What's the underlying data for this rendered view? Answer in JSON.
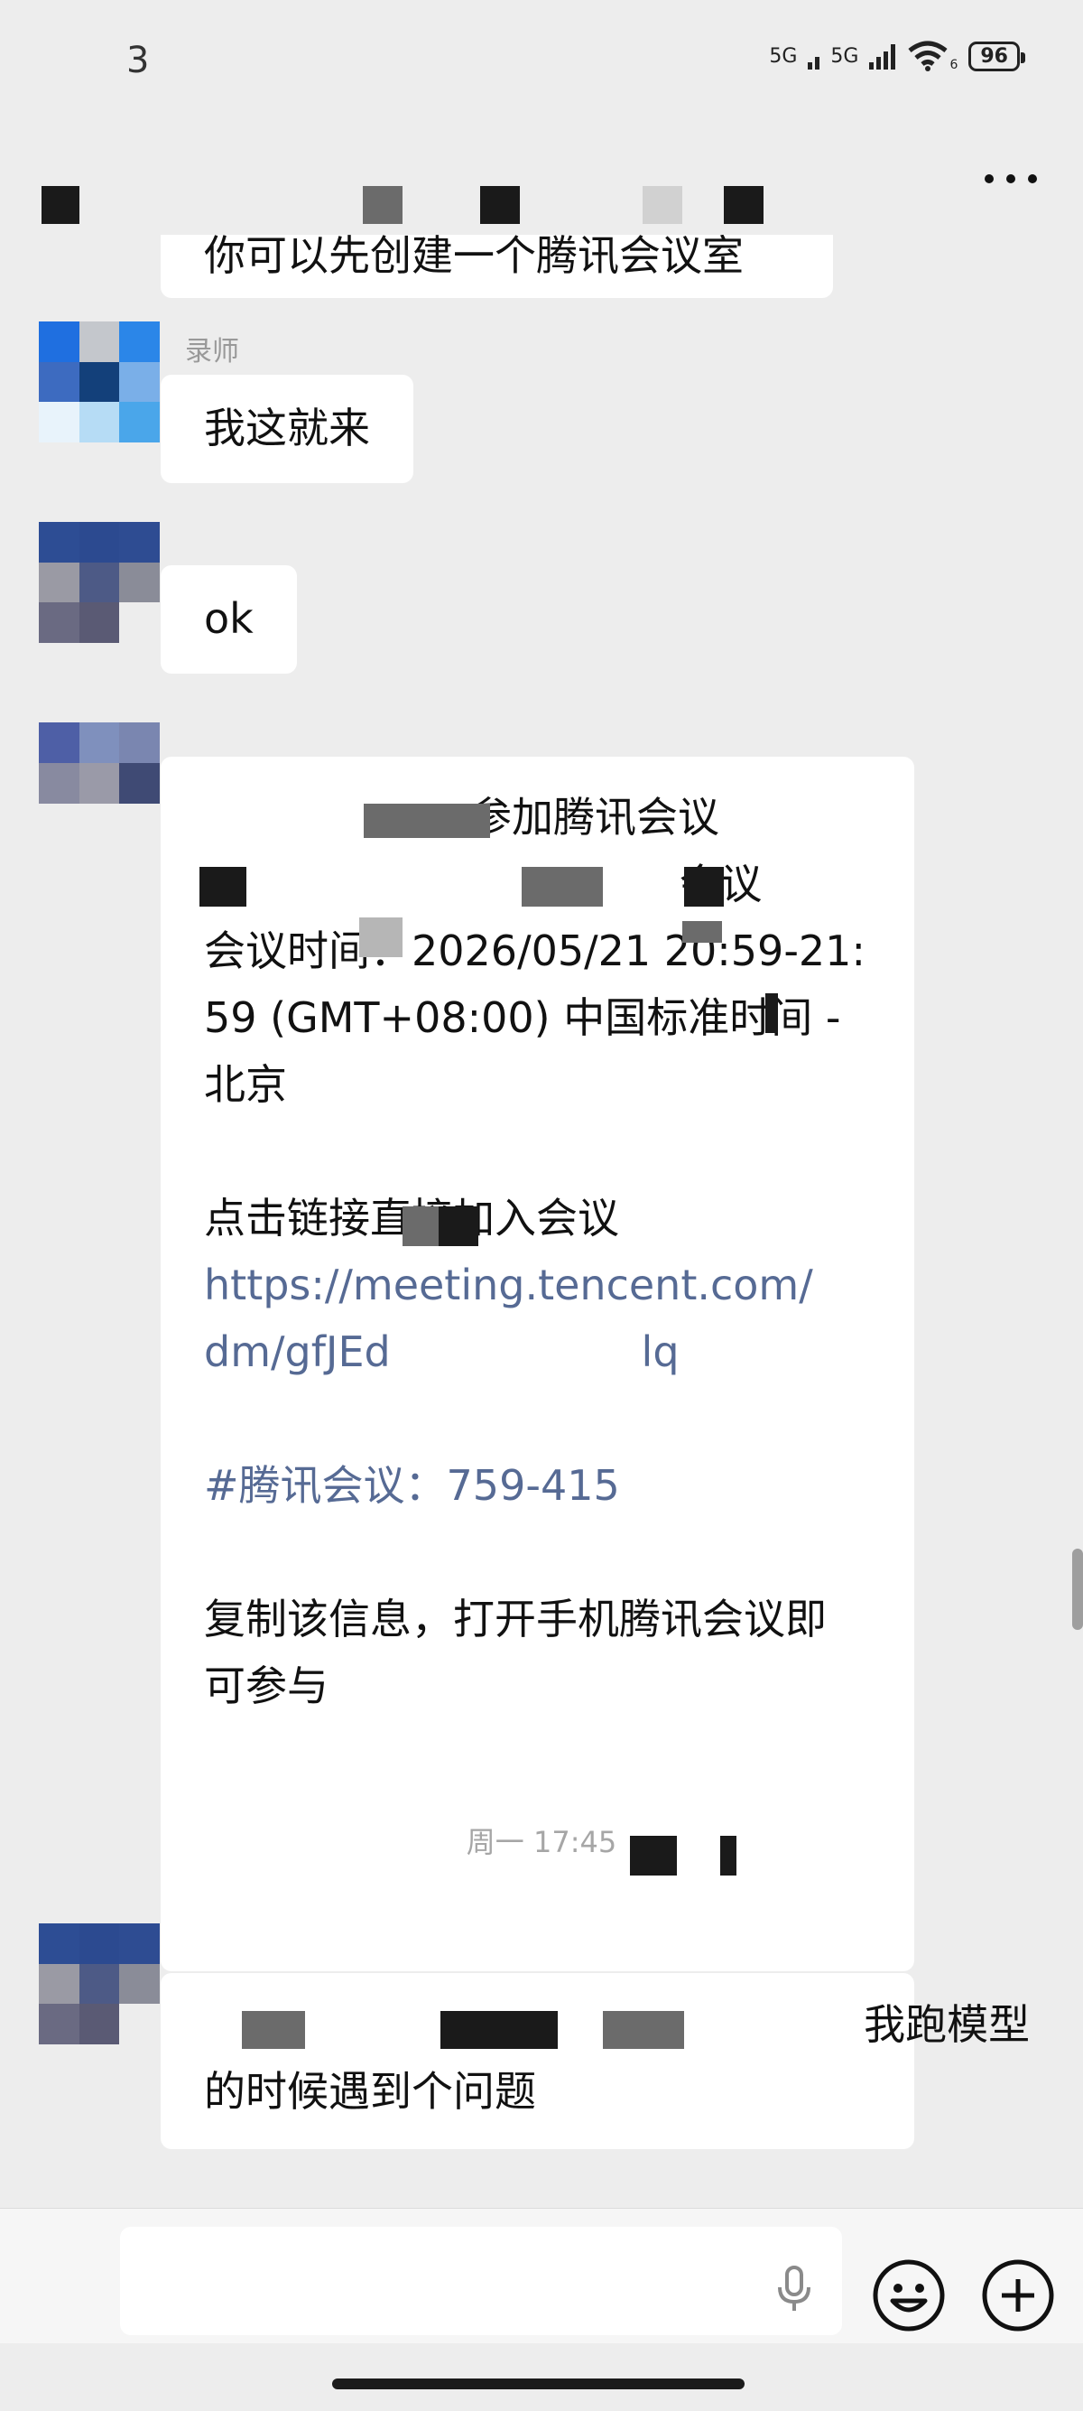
{
  "status_bar": {
    "time": "3",
    "network_1": "5G",
    "network_2": "5G",
    "wifi_sub": "6",
    "battery": "96"
  },
  "nav": {
    "title": "",
    "more_icon": "more-dots-icon"
  },
  "messages": {
    "m1": {
      "text": "你可以先创建一个腾讯会议室"
    },
    "m2": {
      "sender": "录师",
      "text": "我这就来"
    },
    "m3": {
      "text": "ok"
    },
    "m4": {
      "lines": [
        "参加腾讯会议",
        "                                    会议",
        "会议时间：2026/05/21 20:59-21:",
        "59 (GMT+08:00) 中国标准时间 -",
        "北京",
        "点击链接直接加入会议",
        "#腾讯会议：759-415",
        "复制该信息，打开手机腾讯会议即",
        "可参与"
      ],
      "link_lines": [
        "https://meeting.tencent.com/",
        "dm/gfJEd                   lq"
      ]
    },
    "timestamp": "周一 17:45",
    "m5": {
      "lines": [
        "                                                  我跑模型",
        "的时候遇到个问题"
      ]
    }
  },
  "input_bar": {
    "voice_icon": "microphone-icon",
    "emoji_icon": "emoji-icon",
    "plus_icon": "plus-icon"
  },
  "colors": {
    "background": "#ededed",
    "bubble": "#ffffff",
    "link": "#566a94",
    "timestamp": "#a6a6a6"
  }
}
